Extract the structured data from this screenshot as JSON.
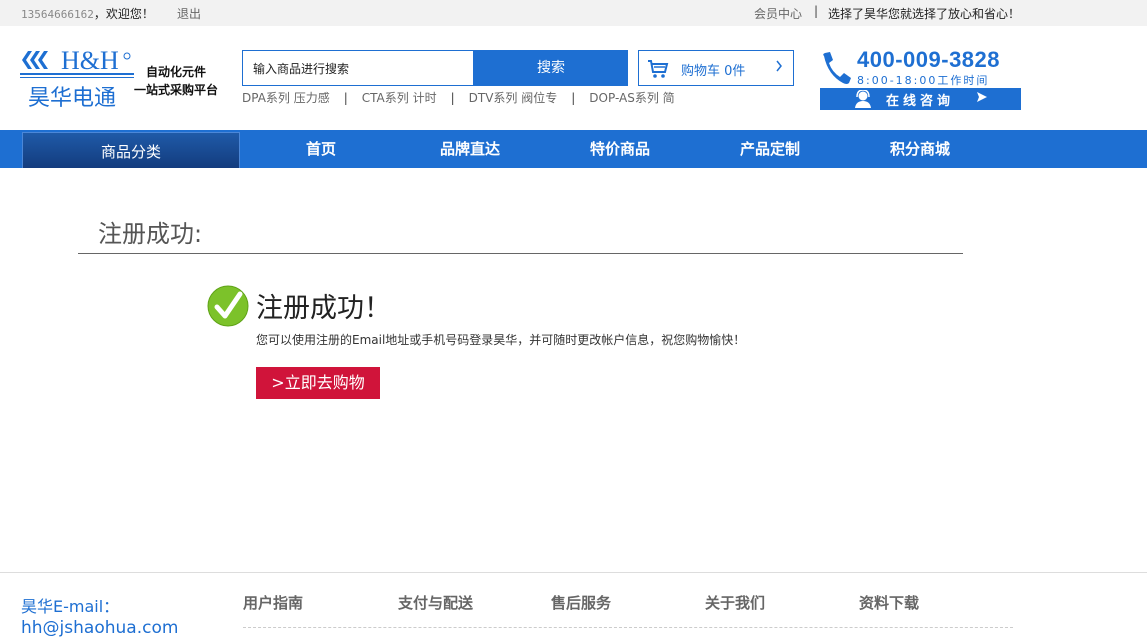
{
  "topbar": {
    "phone": "13564666162",
    "greeting": "，欢迎您！",
    "logout": "退出",
    "member_center": "会员中心",
    "separator": "|",
    "slogan": "选择了昊华您就选择了放心和省心！"
  },
  "logo": {
    "brand": "H&H",
    "brand_cn": "昊华电通",
    "slogan_line1": "自动化元件",
    "slogan_line2": "一站式采购平台"
  },
  "search": {
    "value": "输入商品进行搜索",
    "button": "搜索",
    "hot_links": [
      "DPA系列 压力感",
      "CTA系列 计时",
      "DTV系列 阀位专",
      "DOP-AS系列 简"
    ],
    "hot_sep": "|"
  },
  "cart": {
    "label": "购物车 0件",
    "icon": "cart-icon"
  },
  "hotline": {
    "number": "400-009-3828",
    "hours": "8:00-18:00工作时间",
    "consult": "在线咨询"
  },
  "nav": {
    "category": "商品分类",
    "items": [
      "首页",
      "品牌直达",
      "特价商品",
      "产品定制",
      "积分商城"
    ]
  },
  "main": {
    "heading": "注册成功:",
    "title": "注册成功！",
    "description": "您可以使用注册的Email地址或手机号码登录昊华，并可随时更改帐户信息，祝您购物愉快！",
    "shop_button": ">立即去购物"
  },
  "footer": {
    "email_label": "昊华E-mail：",
    "email": "hh@jshaohua.com",
    "columns": [
      "用户指南",
      "支付与配送",
      "售后服务",
      "关于我们",
      "资料下载"
    ]
  },
  "colors": {
    "primary": "#1e6fd2",
    "nav_dark": "#133c7e",
    "cta": "#d0143a",
    "success": "#7cc22a"
  }
}
